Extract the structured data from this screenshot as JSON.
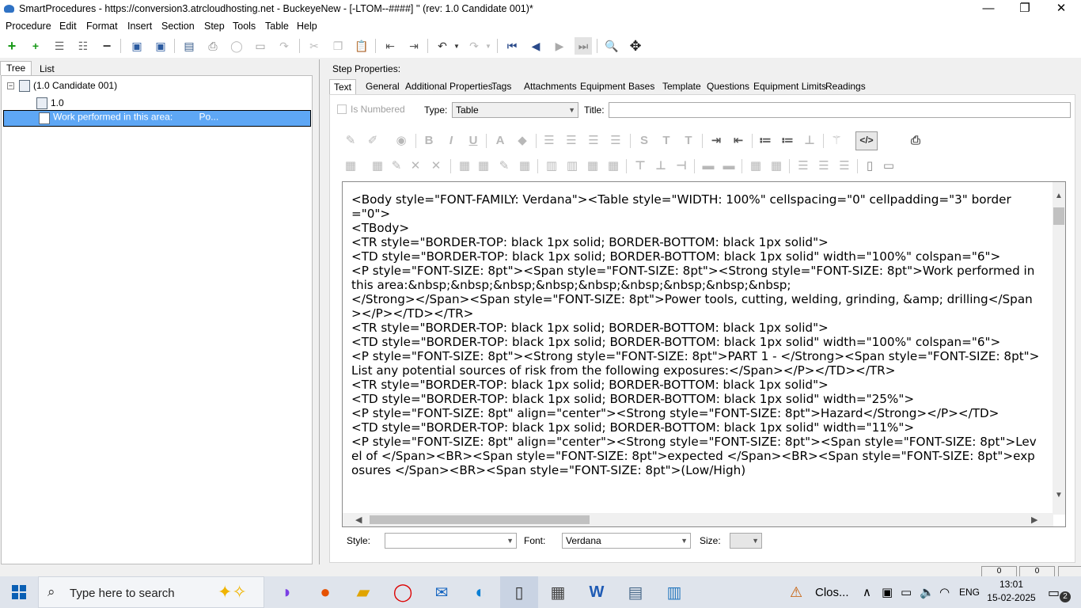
{
  "window": {
    "title": "SmartProcedures - https://conversion3.atrcloudhosting.net - BuckeyeNew - [-LTOM--####] '' (rev: 1.0 Candidate 001)*",
    "minimize": "—",
    "maximize": "❐",
    "close": "✕"
  },
  "menu": {
    "procedure": "Procedure",
    "edit": "Edit",
    "format": "Format",
    "insert": "Insert",
    "section": "Section",
    "step": "Step",
    "tools": "Tools",
    "table": "Table",
    "help": "Help"
  },
  "left_tabs": {
    "tree": "Tree",
    "list": "List"
  },
  "tree": {
    "root": "(1.0 Candidate 001)",
    "child": "1.0",
    "selected": "Work performed in this area:          Po..."
  },
  "step_properties_label": "Step Properties:",
  "prop_tabs": [
    "Text",
    "General",
    "Additional Properties",
    "Tags",
    "Attachments",
    "Equipment",
    "Bases",
    "Template",
    "Questions",
    "Equipment Limits",
    "Readings"
  ],
  "text_tab": {
    "is_numbered_label": "Is Numbered",
    "type_label": "Type:",
    "type_value": "Table",
    "title_label": "Title:",
    "title_value": ""
  },
  "editor": {
    "html_source": "<Body style=\"FONT-FAMILY: Verdana\"><Table style=\"WIDTH: 100%\" cellspacing=\"0\" cellpadding=\"3\" border=\"0\">\n<TBody>\n<TR style=\"BORDER-TOP: black 1px solid; BORDER-BOTTOM: black 1px solid\">\n<TD style=\"BORDER-TOP: black 1px solid; BORDER-BOTTOM: black 1px solid\" width=\"100%\" colspan=\"6\">\n<P style=\"FONT-SIZE: 8pt\"><Span style=\"FONT-SIZE: 8pt\"><Strong style=\"FONT-SIZE: 8pt\">Work performed in this area:&nbsp;&nbsp;&nbsp;&nbsp;&nbsp;&nbsp;&nbsp;&nbsp;&nbsp;\n</Strong></Span><Span style=\"FONT-SIZE: 8pt\">Power tools, cutting, welding, grinding, &amp; drilling</Span></P></TD></TR>\n<TR style=\"BORDER-TOP: black 1px solid; BORDER-BOTTOM: black 1px solid\">\n<TD style=\"BORDER-TOP: black 1px solid; BORDER-BOTTOM: black 1px solid\" width=\"100%\" colspan=\"6\">\n<P style=\"FONT-SIZE: 8pt\"><Strong style=\"FONT-SIZE: 8pt\">PART 1 - </Strong><Span style=\"FONT-SIZE: 8pt\">List any potential sources of risk from the following exposures:</Span></P></TD></TR>\n<TR style=\"BORDER-TOP: black 1px solid; BORDER-BOTTOM: black 1px solid\">\n<TD style=\"BORDER-TOP: black 1px solid; BORDER-BOTTOM: black 1px solid\" width=\"25%\">\n<P style=\"FONT-SIZE: 8pt\" align=\"center\"><Strong style=\"FONT-SIZE: 8pt\">Hazard</Strong></P></TD>\n<TD style=\"BORDER-TOP: black 1px solid; BORDER-BOTTOM: black 1px solid\" width=\"11%\">\n<P style=\"FONT-SIZE: 8pt\" align=\"center\"><Strong style=\"FONT-SIZE: 8pt\"><Span style=\"FONT-SIZE: 8pt\">Level of </Span><BR><Span style=\"FONT-SIZE: 8pt\">expected </Span><BR><Span style=\"FONT-SIZE: 8pt\">exposures </Span><BR><Span style=\"FONT-SIZE: 8pt\">(Low/High)"
  },
  "bottom": {
    "style_label": "Style:",
    "style_value": "",
    "font_label": "Font:",
    "font_value": "Verdana",
    "size_label": "Size:",
    "size_value": ""
  },
  "status": {
    "left_count": "0",
    "right_count": "0"
  },
  "taskbar": {
    "search_placeholder": "Type here to search",
    "notification_text": "Clos...",
    "language": "ENG",
    "time": "13:01",
    "date": "15-02-2025",
    "notif_count": "2"
  }
}
